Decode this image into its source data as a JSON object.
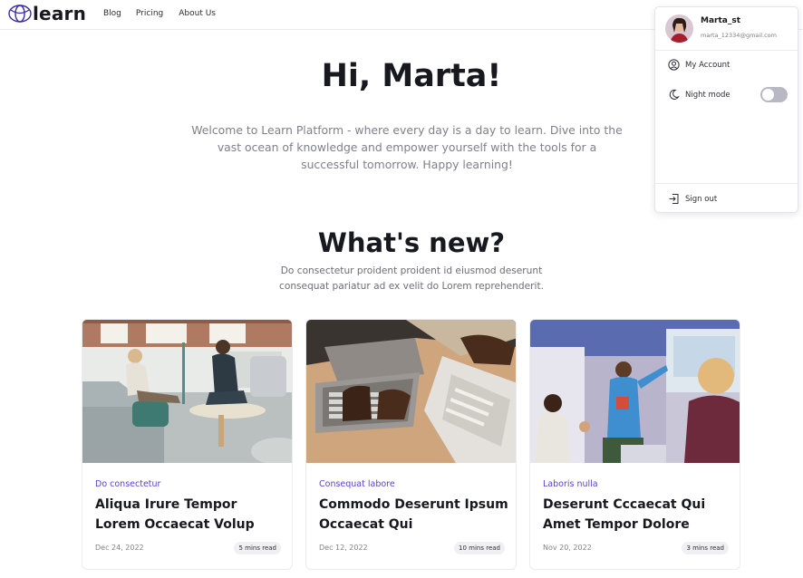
{
  "header": {
    "logo_text": "learn",
    "nav": [
      "Blog",
      "Pricing",
      "About Us"
    ]
  },
  "hero": {
    "title": "Hi, Marta!",
    "text": "Welcome to Learn Platform - where every day is a day to learn. Dive into the vast ocean of knowledge and empower yourself with the tools for a successful tomorrow. Happy learning!"
  },
  "whats_new": {
    "title": "What's new?",
    "text": "Do consectetur proident proident id eiusmod deserunt consequat pariatur ad ex velit do Lorem reprehenderit."
  },
  "cards": [
    {
      "category": "Do consectetur",
      "title": "Aliqua Irure Tempor Lorem Occaecat Volup",
      "date": "Dec 24, 2022",
      "read": "5 mins read"
    },
    {
      "category": "Consequat labore",
      "title": "Commodo Deserunt Ipsum Occaecat Qui",
      "date": "Dec 12, 2022",
      "read": "10 mins read"
    },
    {
      "category": "Laboris nulla",
      "title": "Deserunt Cccaecat Qui Amet Tempor Dolore",
      "date": "Nov 20, 2022",
      "read": "3 mins read"
    }
  ],
  "dropdown": {
    "username": "Marta_st",
    "email": "marta_12334@gmail.com",
    "my_account": "My Account",
    "night_mode": "Night mode",
    "night_mode_on": false,
    "sign_out": "Sign out"
  },
  "colors": {
    "accent": "#5a3fd1",
    "text_dark": "#18181f",
    "muted": "#80808c"
  }
}
